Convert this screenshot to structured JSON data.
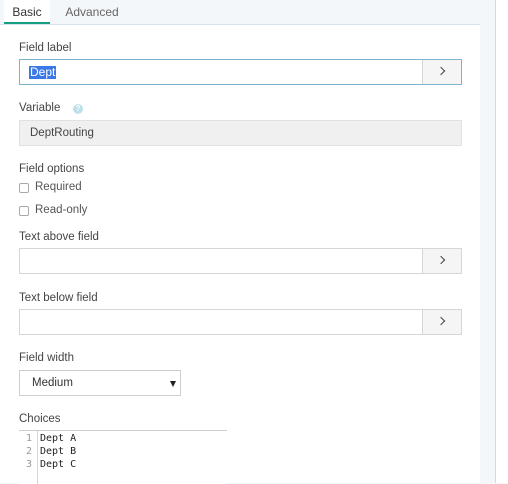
{
  "tabs": {
    "basic": "Basic",
    "advanced": "Advanced"
  },
  "field_label": {
    "label": "Field label",
    "value": "Dept"
  },
  "variable": {
    "label": "Variable",
    "value": "DeptRouting",
    "help": "?"
  },
  "field_options": {
    "label": "Field options",
    "required": "Required",
    "readonly": "Read-only"
  },
  "text_above": {
    "label": "Text above field",
    "value": ""
  },
  "text_below": {
    "label": "Text below field",
    "value": ""
  },
  "field_width": {
    "label": "Field width",
    "value": "Medium"
  },
  "choices": {
    "label": "Choices",
    "lines": [
      {
        "num": "1",
        "text": "Dept A"
      },
      {
        "num": "2",
        "text": "Dept B"
      },
      {
        "num": "3",
        "text": "Dept C"
      }
    ]
  },
  "colors": {
    "accent": "#179d82",
    "selection": "#3b78e7"
  },
  "icons": {
    "expand": "chevron-right-icon",
    "help": "help-icon",
    "dropdown": "caret-down-icon"
  }
}
